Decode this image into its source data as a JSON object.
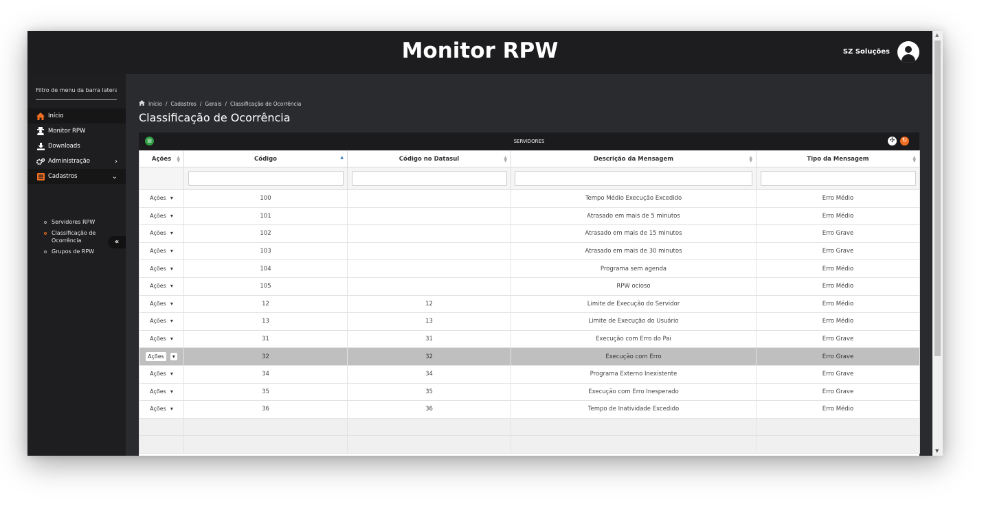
{
  "header": {
    "title": "Monitor RPW",
    "user_name": "SZ Soluções"
  },
  "sidebar": {
    "filter_placeholder": "Filtro de menu da barra lateral...",
    "items": [
      {
        "label": "Início",
        "icon": "home-icon"
      },
      {
        "label": "Monitor RPW",
        "icon": "user-secret-icon"
      },
      {
        "label": "Downloads",
        "icon": "download-icon"
      },
      {
        "label": "Administração",
        "icon": "cogs-icon"
      },
      {
        "label": "Cadastros",
        "icon": "list-icon"
      }
    ],
    "subitems": [
      {
        "label": "Servidores RPW"
      },
      {
        "label": "Classificação de Ocorrência"
      },
      {
        "label": "Grupos de RPW"
      }
    ],
    "collapse_label": "«"
  },
  "breadcrumb": {
    "home": "Início",
    "sep": "/",
    "items": [
      "Cadastros",
      "Gerais",
      "Classificação de Ocorrência"
    ]
  },
  "page_title": "Classificação de Ocorrência",
  "grid": {
    "title": "SERVIDORES",
    "columns": [
      "Ações",
      "Código",
      "Código no Datasul",
      "Descrição da Mensagem",
      "Tipo da Mensagem"
    ],
    "action_label": "Ações",
    "rows": [
      {
        "codigo": "100",
        "datasul": "",
        "descricao": "Tempo Médio Execução Excedido",
        "tipo": "Erro Médio"
      },
      {
        "codigo": "101",
        "datasul": "",
        "descricao": "Atrasado em mais de 5 minutos",
        "tipo": "Erro Médio"
      },
      {
        "codigo": "102",
        "datasul": "",
        "descricao": "Atrasado em mais de 15 minutos",
        "tipo": "Erro Grave"
      },
      {
        "codigo": "103",
        "datasul": "",
        "descricao": "Atrasado em mais de 30 minutos",
        "tipo": "Erro Grave"
      },
      {
        "codigo": "104",
        "datasul": "",
        "descricao": "Programa sem agenda",
        "tipo": "Erro Médio"
      },
      {
        "codigo": "105",
        "datasul": "",
        "descricao": "RPW ocioso",
        "tipo": "Erro Médio"
      },
      {
        "codigo": "12",
        "datasul": "12",
        "descricao": "Limite de Execução do Servidor",
        "tipo": "Erro Médio"
      },
      {
        "codigo": "13",
        "datasul": "13",
        "descricao": "Limite de Execução do Usuário",
        "tipo": "Erro Médio"
      },
      {
        "codigo": "31",
        "datasul": "31",
        "descricao": "Execução com Erro do Pai",
        "tipo": "Erro Grave"
      },
      {
        "codigo": "32",
        "datasul": "32",
        "descricao": "Execução com Erro",
        "tipo": "Erro Grave"
      },
      {
        "codigo": "34",
        "datasul": "34",
        "descricao": "Programa Externo Inexistente",
        "tipo": "Erro Grave"
      },
      {
        "codigo": "35",
        "datasul": "35",
        "descricao": "Execução com Erro Inesperado",
        "tipo": "Erro Grave"
      },
      {
        "codigo": "36",
        "datasul": "36",
        "descricao": "Tempo de Inatividade Excedido",
        "tipo": "Erro Médio"
      }
    ]
  }
}
